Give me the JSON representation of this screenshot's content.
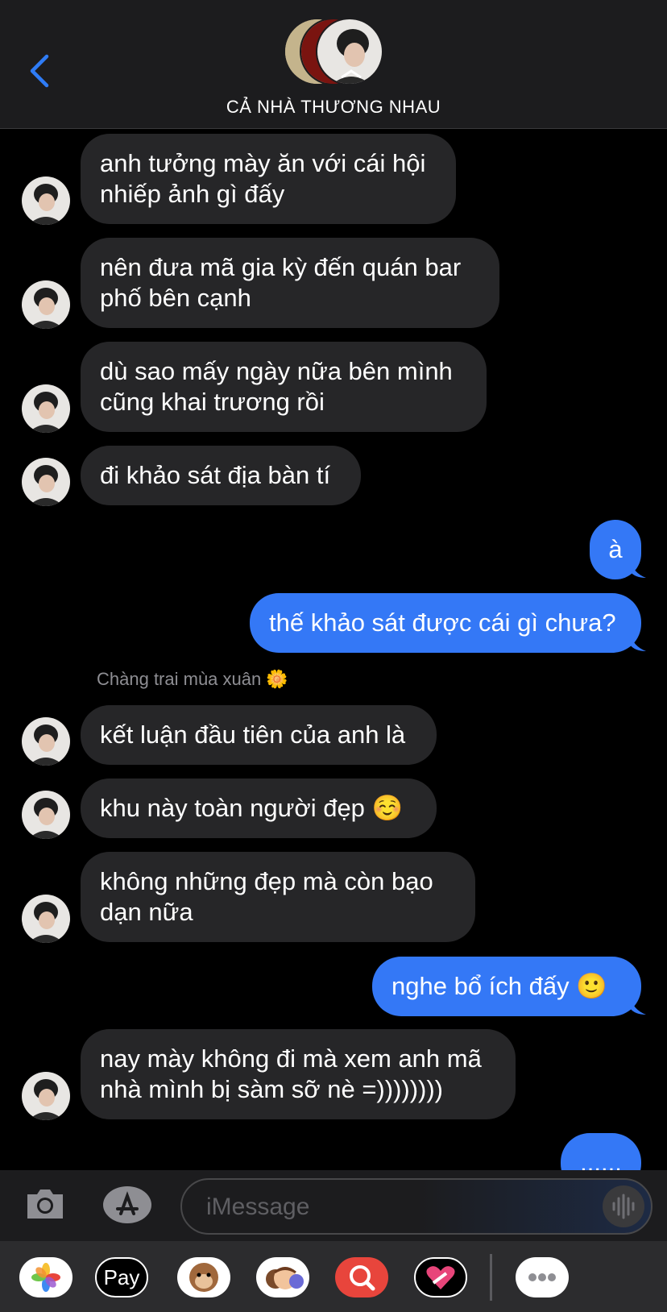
{
  "header": {
    "group_name": "CẢ NHÀ THƯƠNG NHAU",
    "back_icon": "chevron-left-icon"
  },
  "messages": [
    {
      "side": "in",
      "text": "anh tưởng mày ăn với cái hội\nnhiếp ảnh gì đấy"
    },
    {
      "side": "in",
      "text": "nên đưa mã gia kỳ đến quán bar\nphố bên cạnh"
    },
    {
      "side": "in",
      "text": "dù sao mấy ngày nữa bên mình\ncũng khai trương rồi"
    },
    {
      "side": "in",
      "text": "đi khảo sát địa bàn tí"
    },
    {
      "side": "out",
      "text": "à"
    },
    {
      "side": "out",
      "text": "thế khảo sát được cái gì chưa?"
    },
    {
      "side": "sender",
      "text": "Chàng trai mùa xuân 🌼"
    },
    {
      "side": "in",
      "text": "kết luận đầu tiên của anh là"
    },
    {
      "side": "in",
      "text": "khu này toàn người đẹp ☺️"
    },
    {
      "side": "in",
      "text": "không những đẹp mà còn bạo\ndạn nữa"
    },
    {
      "side": "out",
      "text": "nghe bổ ích đấy 🙂"
    },
    {
      "side": "in",
      "text": "nay mày không đi mà xem anh mã\nnhà mình bị sàm sỡ nè =))))))))"
    },
    {
      "side": "out",
      "text": "......"
    }
  ],
  "input": {
    "placeholder": "iMessage",
    "camera_icon": "camera-icon",
    "appstore_icon": "app-store-icon",
    "voice_icon": "waveform-icon"
  },
  "apps": [
    {
      "name": "photos-app-icon"
    },
    {
      "name": "apple-pay-app-icon",
      "label": "Pay"
    },
    {
      "name": "animoji-app-icon"
    },
    {
      "name": "memoji-app-icon"
    },
    {
      "name": "image-search-app-icon"
    },
    {
      "name": "digital-touch-app-icon"
    },
    {
      "name": "more-apps-icon"
    }
  ]
}
